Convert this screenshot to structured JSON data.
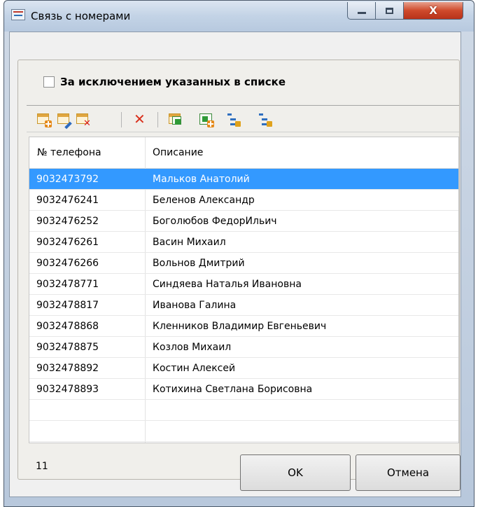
{
  "window": {
    "title": "Связь с номерами",
    "close_glyph": "X",
    "accent_color": "#3399ff"
  },
  "options": {
    "exclude_label": "За исключением указанных в списке",
    "exclude_checked": false
  },
  "toolbar": {
    "icons": [
      "add-icon",
      "edit-icon",
      "delete-record-icon",
      "delete-icon",
      "export-excel-icon",
      "import-excel-icon",
      "tree-expand-icon",
      "tree-collapse-icon"
    ]
  },
  "grid": {
    "columns": [
      "№ телефона",
      "Описание"
    ],
    "selected_index": 0,
    "rows": [
      {
        "phone": "9032473792",
        "desc": "Мальков Анатолий"
      },
      {
        "phone": "9032476241",
        "desc": "Беленов Александр"
      },
      {
        "phone": "9032476252",
        "desc": "Боголюбов ФедорИльич"
      },
      {
        "phone": "9032476261",
        "desc": "Васин Михаил"
      },
      {
        "phone": "9032476266",
        "desc": "Вольнов Дмитрий"
      },
      {
        "phone": "9032478771",
        "desc": "Синдяева Наталья Ивановна"
      },
      {
        "phone": "9032478817",
        "desc": "Иванова Галина"
      },
      {
        "phone": "9032478868",
        "desc": "Кленников Владимир Евгеньевич"
      },
      {
        "phone": "9032478875",
        "desc": "Козлов Михаил"
      },
      {
        "phone": "9032478892",
        "desc": "Костин Алексей"
      },
      {
        "phone": "9032478893",
        "desc": "Котихина Светлана Борисовна"
      }
    ]
  },
  "footer": {
    "count": "11",
    "ok_label": "OK",
    "cancel_label": "Отмена"
  }
}
